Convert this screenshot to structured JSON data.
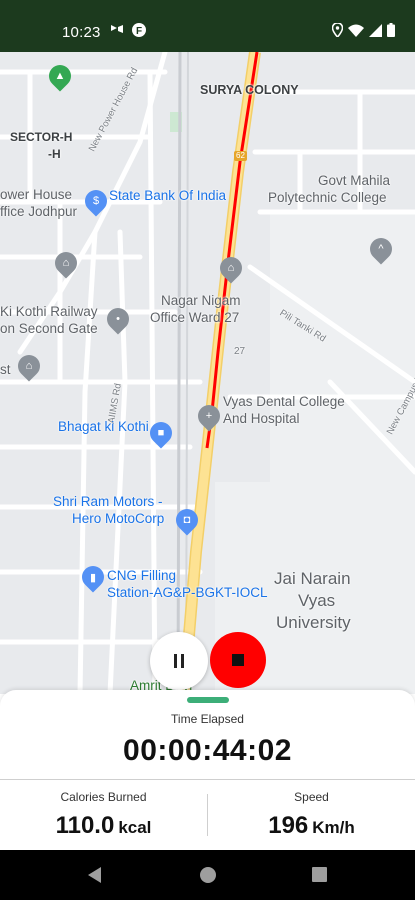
{
  "status_bar": {
    "time": "10:23",
    "left_icons": [
      "cast-icon",
      "app-notification-icon"
    ],
    "right_icons": [
      "location-icon",
      "wifi-icon",
      "signal-icon",
      "battery-icon"
    ]
  },
  "map": {
    "labels": [
      {
        "key": "surya_colony",
        "text": "SURYA COLONY"
      },
      {
        "key": "sector_h_1",
        "text": "SECTOR-H"
      },
      {
        "key": "sector_h_2",
        "text": "-H"
      },
      {
        "key": "new_power_house_rd",
        "text": "New Power House Rd"
      },
      {
        "key": "power_house",
        "text": "ower House"
      },
      {
        "key": "office_jodhpur",
        "text": "ffice Jodhpur"
      },
      {
        "key": "sbi",
        "text": "State Bank Of India"
      },
      {
        "key": "govt_mahila_1",
        "text": "Govt Mahila"
      },
      {
        "key": "govt_mahila_2",
        "text": "Polytechnic College"
      },
      {
        "key": "route_62",
        "text": "62"
      },
      {
        "key": "ki_kothi_1",
        "text": "Ki Kothi Railway"
      },
      {
        "key": "ki_kothi_2",
        "text": "on Second Gate"
      },
      {
        "key": "nagar_nigam_1",
        "text": "Nagar Nigam"
      },
      {
        "key": "nagar_nigam_2",
        "text": "Office Ward 27"
      },
      {
        "key": "pili_tanki",
        "text": "Pili Tanki Rd"
      },
      {
        "key": "ward_27",
        "text": "27"
      },
      {
        "key": "st",
        "text": "st"
      },
      {
        "key": "aiims_rd",
        "text": "AIIMS Rd"
      },
      {
        "key": "vyas_dental_1",
        "text": "Vyas Dental College"
      },
      {
        "key": "vyas_dental_2",
        "text": "And Hospital"
      },
      {
        "key": "new_campus_rd",
        "text": "New Campus Rd"
      },
      {
        "key": "bhagat_ki_kothi",
        "text": "Bhagat ki Kothi"
      },
      {
        "key": "shri_ram_1",
        "text": "Shri Ram Motors -"
      },
      {
        "key": "shri_ram_2",
        "text": "Hero MotoCorp"
      },
      {
        "key": "cng_1",
        "text": "CNG Filling"
      },
      {
        "key": "cng_2",
        "text": "Station-AG&P-BGKT-IOCL"
      },
      {
        "key": "jnvu_1",
        "text": "Jai Narain"
      },
      {
        "key": "jnvu_2",
        "text": "Vyas"
      },
      {
        "key": "jnvu_3",
        "text": "University"
      },
      {
        "key": "amrit",
        "text": "Amrit Devi"
      }
    ]
  },
  "controls": {
    "pause_icon": "pause-icon",
    "stop_icon": "stop-icon"
  },
  "tracker": {
    "elapsed_label": "Time Elapsed",
    "elapsed_value": "00:00:44:02",
    "calories_label": "Calories Burned",
    "calories_value": "110.0",
    "calories_unit": "kcal",
    "speed_label": "Speed",
    "speed_value": "196",
    "speed_unit": "Km/h"
  },
  "colors": {
    "status_bar": "#1c3a1e",
    "route": "#ff0000",
    "stop_button": "#ff0000",
    "handle": "#3cae78",
    "main_road": "#fde293"
  },
  "nav_bar": {
    "buttons": [
      "back-icon",
      "home-icon",
      "recents-icon"
    ]
  }
}
